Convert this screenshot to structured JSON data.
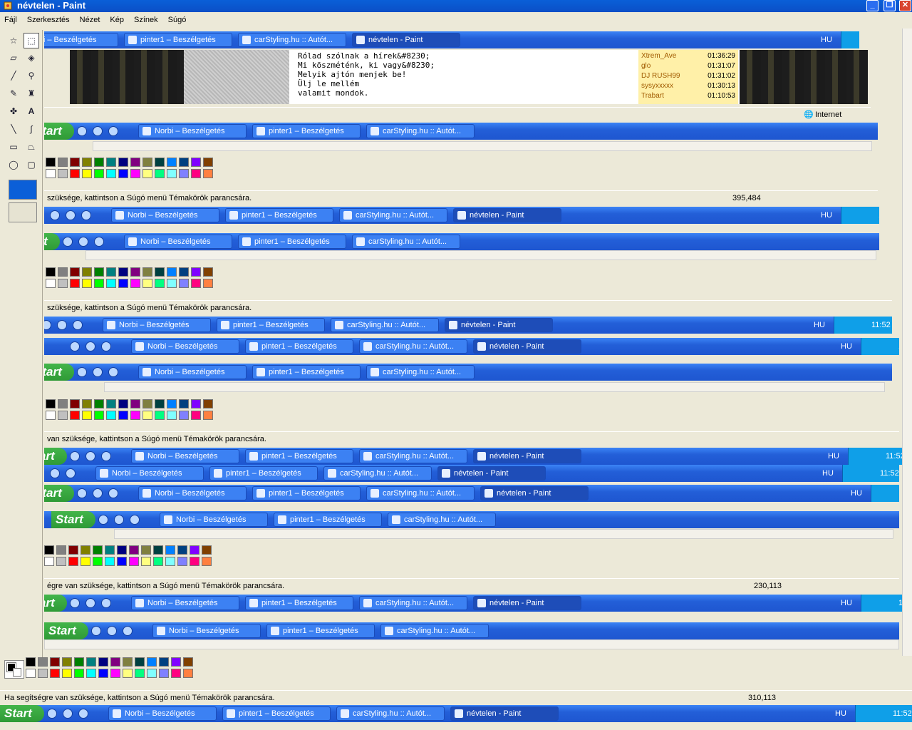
{
  "window": {
    "title": "névtelen - Paint",
    "min": "_",
    "max": "❐",
    "close": "✕"
  },
  "menu": [
    "Fájl",
    "Szerkesztés",
    "Nézet",
    "Kép",
    "Színek",
    "Súgó"
  ],
  "taskbar": {
    "start": "Start",
    "tasks": [
      "Norbi – Beszélgetés",
      "pinter1 – Beszélgetés",
      "carStyling.hu :: Autót...",
      "névtelen - Paint"
    ],
    "lang": "HU",
    "clock": "11:52"
  },
  "chat": {
    "lines": [
      "Rólad szólnak a hírek&#8230;",
      "Mi köszméténk, ki vagy&#8230;",
      "Melyik ajtón menjek be!",
      "Ülj le mellém",
      "valamit mondok."
    ],
    "users": [
      {
        "name": "Xtrem_Ave",
        "time": "01:36:29"
      },
      {
        "name": "glo",
        "time": "01:31:07"
      },
      {
        "name": "DJ RUSH99",
        "time": "01:31:02"
      },
      {
        "name": "sysyxxxxx",
        "time": "01:30:13"
      },
      {
        "name": "Trabart",
        "time": "01:10:53"
      }
    ],
    "ie_status": "Internet"
  },
  "status": {
    "help_full": "Ha segítségre van szüksége, kattintson a Súgó menü Témakörök parancsára.",
    "help_1": "szüksége, kattintson a Súgó menü Témakörök parancsára.",
    "help_2": "szüksége, kattintson a Súgó menü Témakörök parancsára.",
    "help_3": "van szüksége, kattintson a Súgó menü Témakörök parancsára.",
    "help_4": "égre van szüksége, kattintson a Súgó menü Témakörök parancsára.",
    "coord_1": "395,484",
    "coord_4": "230,113",
    "coord_main": "310,113"
  },
  "palette_top": [
    "#000000",
    "#808080",
    "#800000",
    "#808000",
    "#008000",
    "#008080",
    "#000080",
    "#800080",
    "#808040",
    "#004040",
    "#0080ff",
    "#004080",
    "#8000ff",
    "#804000"
  ],
  "palette_bottom": [
    "#ffffff",
    "#c0c0c0",
    "#ff0000",
    "#ffff00",
    "#00ff00",
    "#00ffff",
    "#0000ff",
    "#ff00ff",
    "#ffff80",
    "#00ff80",
    "#80ffff",
    "#8080ff",
    "#ff0080",
    "#ff8040"
  ]
}
